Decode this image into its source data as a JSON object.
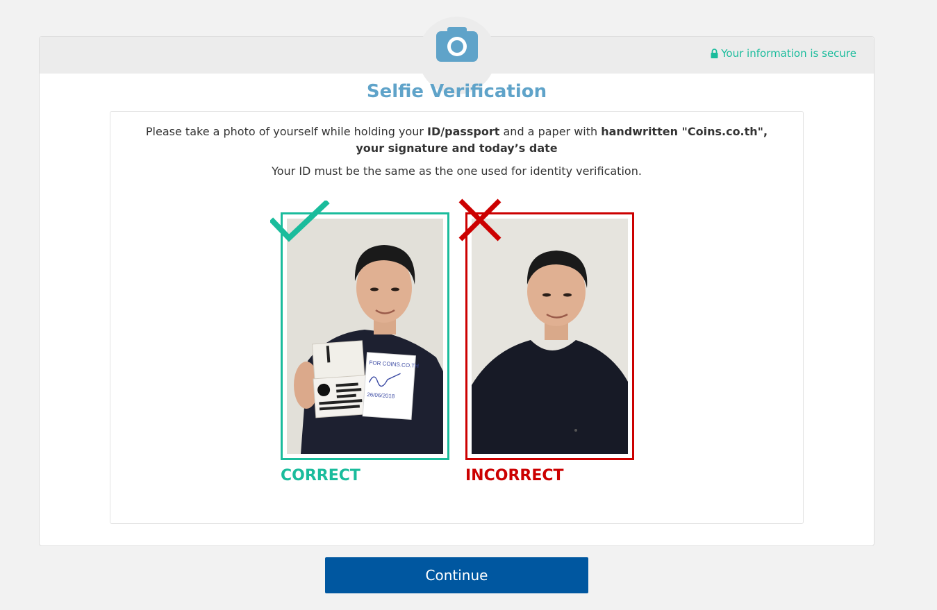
{
  "header": {
    "secure_text": "Your information is secure",
    "camera_icon": "camera-icon",
    "lock_icon": "lock-icon"
  },
  "title": "Selfie Verification",
  "instructions": {
    "part1": "Please take a photo of yourself while holding your ",
    "bold1": "ID/passport",
    "part2": " and a paper with ",
    "bold2": "handwritten \"Coins.co.th\", your signature and today’s date",
    "note": "Your ID must be the same as the one used for identity verification."
  },
  "examples": {
    "correct": {
      "label": "CORRECT",
      "icon": "checkmark-icon",
      "paper_line1": "FOR COINS.CO.TH",
      "paper_line2": "26/06/2018"
    },
    "incorrect": {
      "label": "INCORRECT",
      "icon": "cross-icon"
    }
  },
  "colors": {
    "accent_green": "#1abc9c",
    "error_red": "#cc0000",
    "title_blue": "#5fa3c9",
    "button_blue": "#0057a0"
  },
  "continue_label": "Continue"
}
